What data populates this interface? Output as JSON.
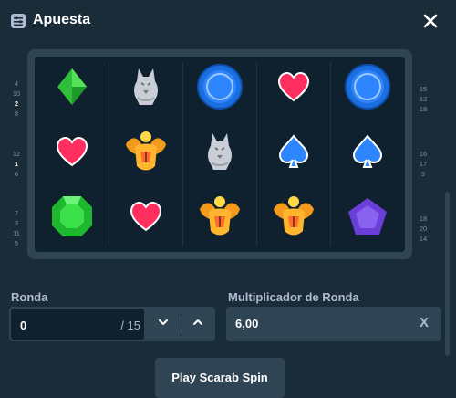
{
  "header": {
    "title": "Apuesta",
    "icon": "sliders-icon",
    "close_icon": "close-icon"
  },
  "board": {
    "left_numbers": [
      [
        "4",
        "10",
        "2",
        "8"
      ],
      [
        "12",
        "1",
        "6"
      ],
      [
        "7",
        "3",
        "11",
        "5"
      ]
    ],
    "left_highlight": [
      "2",
      "1"
    ],
    "right_numbers": [
      [
        "15",
        "13",
        "19"
      ],
      [
        "16",
        "17",
        "9"
      ],
      [
        "18",
        "20",
        "14"
      ]
    ],
    "grid": [
      [
        "green-diamond",
        "silver-wolf",
        "blue-coin",
        "red-heart",
        "blue-coin"
      ],
      [
        "red-heart",
        "golden-scarab",
        "silver-wolf",
        "blue-spade",
        "blue-spade"
      ],
      [
        "green-emerald",
        "red-heart",
        "golden-scarab",
        "golden-scarab",
        "purple-pentagon"
      ]
    ]
  },
  "form": {
    "round_label": "Ronda",
    "round_value": "0",
    "round_total": "/ 15",
    "multiplier_label": "Multiplicador de Ronda",
    "multiplier_value": "6,00",
    "multiplier_clear": "X"
  },
  "play_button": {
    "label": "Play Scarab Spin"
  },
  "colors": {
    "background": "#1a2c38",
    "panel": "#2f4553",
    "board": "#0f212e",
    "muted_text": "#b1bad3"
  }
}
